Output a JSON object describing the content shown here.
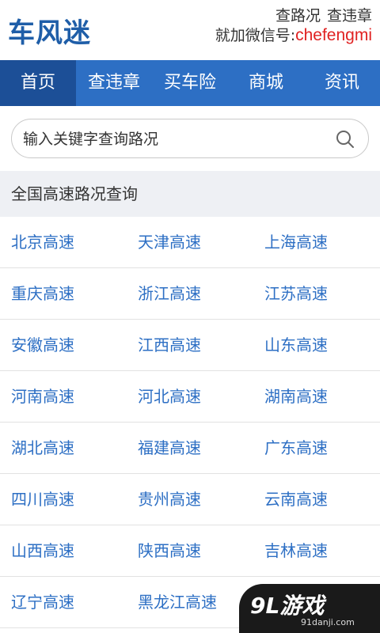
{
  "header": {
    "logo": "车风迷",
    "links": [
      "查路况",
      "查违章"
    ],
    "wechat_label": "就加微信号:",
    "wechat_id": "chefengmi"
  },
  "nav": {
    "items": [
      {
        "label": "首页",
        "active": true
      },
      {
        "label": "查违章"
      },
      {
        "label": "买车险"
      },
      {
        "label": "商城"
      },
      {
        "label": "资讯"
      }
    ]
  },
  "search": {
    "placeholder": "输入关键字查询路况",
    "icon": "search-icon"
  },
  "section": {
    "title": "全国高速路况查询"
  },
  "highways": [
    [
      "北京高速",
      "天津高速",
      "上海高速"
    ],
    [
      "重庆高速",
      "浙江高速",
      "江苏高速"
    ],
    [
      "安徽高速",
      "江西高速",
      "山东高速"
    ],
    [
      "河南高速",
      "河北高速",
      "湖南高速"
    ],
    [
      "湖北高速",
      "福建高速",
      "广东高速"
    ],
    [
      "四川高速",
      "贵州高速",
      "云南高速"
    ],
    [
      "山西高速",
      "陕西高速",
      "吉林高速"
    ],
    [
      "辽宁高速",
      "黑龙江高速",
      ""
    ]
  ],
  "watermark": {
    "logo": "9L游戏",
    "url": "91danji.com"
  },
  "colors": {
    "brand": "#1f5ea8",
    "nav_bg": "#2d6fc4",
    "nav_active": "#1c4f97",
    "link": "#2d6fc4",
    "wechat": "#e02222"
  }
}
